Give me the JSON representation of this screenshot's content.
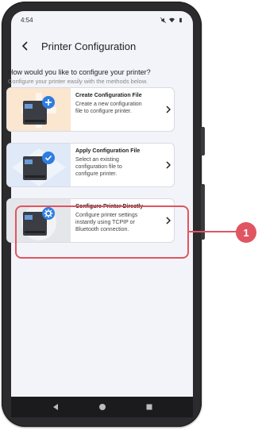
{
  "status_bar": {
    "time": "4:54"
  },
  "app_bar": {
    "title": "Printer Configuration"
  },
  "prompt": {
    "question": "How would you like to configure your printer?",
    "subtitle": "Configure your printer easily with the methods below."
  },
  "cards": [
    {
      "title": "Create Configuration File",
      "description": "Create a new configuration\nfile to configure printer.",
      "badge_icon": "plus-icon",
      "thumb_color": "#fbe6cf"
    },
    {
      "title": "Apply Configuration File",
      "description": "Select an existing\nconfiguration file to\nconfigure printer.",
      "badge_icon": "check-icon",
      "thumb_color": "#dfe9f7"
    },
    {
      "title": "Configure Printer Directly",
      "description": "Configure printer settings\ninstantly using TCPIP or\nBluetooth connection.",
      "badge_icon": "gear-icon",
      "thumb_color": "#e5e6ea"
    }
  ],
  "annotation": {
    "number": "1",
    "color": "#e05561"
  },
  "accent_color": "#2f7de1"
}
